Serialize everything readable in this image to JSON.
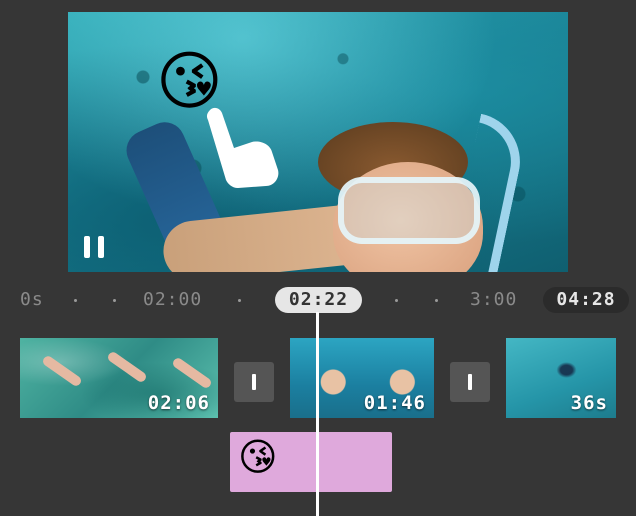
{
  "preview": {
    "sticker_emoji": "😘",
    "sticker_hand_icon": "pointing-hand-icon",
    "pause_icon": "pause-icon"
  },
  "timeline": {
    "ruler": {
      "start_label": "0s",
      "mark_1_label": "02:00",
      "mark_2_label": "3:00",
      "current_time": "02:22",
      "total_duration": "04:28"
    },
    "clips": [
      {
        "duration": "02:06"
      },
      {
        "duration": "01:46"
      },
      {
        "duration": "36s"
      }
    ],
    "transition_icon": "transition-icon",
    "sticker_track": {
      "emoji": "😘",
      "color": "#dfa9dc"
    }
  },
  "colors": {
    "background": "#363636",
    "playhead": "#ffffff",
    "current_pill": "#e6e6e6",
    "total_pill": "#2b2b2b"
  }
}
